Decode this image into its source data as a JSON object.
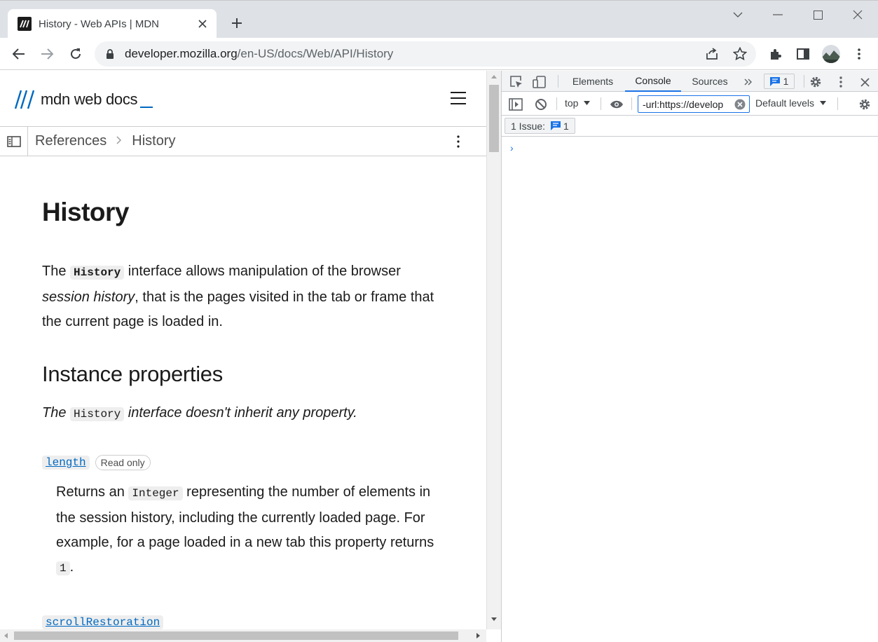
{
  "browser": {
    "tab_title": "History - Web APIs | MDN",
    "url_host": "developer.mozilla.org",
    "url_path": "/en-US/docs/Web/API/History"
  },
  "mdn": {
    "logo_text": "mdn web docs",
    "breadcrumbs": [
      "References",
      "History"
    ],
    "title": "History",
    "intro": {
      "pre": "The ",
      "code": "History",
      "post": " interface allows manipulation of the browser",
      "italic": "session history",
      "rest": ", that is the pages visited in the tab or frame that the current page is loaded in."
    },
    "instance_properties_heading": "Instance properties",
    "inherit_note": {
      "pre": "The ",
      "code": "History",
      "post": " interface doesn't inherit any property."
    },
    "properties": [
      {
        "name": "length",
        "badge": "Read only",
        "desc_pre": "Returns an ",
        "desc_code": "Integer",
        "desc_post": " representing the number of elements in the session history, including the currently loaded page. For example, for a page loaded in a new tab this property returns ",
        "desc_code2": "1",
        "desc_end": "."
      },
      {
        "name": "scrollRestoration"
      }
    ]
  },
  "devtools": {
    "tabs": [
      "Elements",
      "Console",
      "Sources"
    ],
    "active_tab": "Console",
    "issues_badge_count": "1",
    "context": "top",
    "filter_value": "-url:https://develop",
    "levels": "Default levels",
    "issue_label": "1 Issue:",
    "issue_count": "1",
    "prompt": "›"
  },
  "colors": {
    "accent": "#1a73e8",
    "mdn_blue": "#0069c2"
  }
}
